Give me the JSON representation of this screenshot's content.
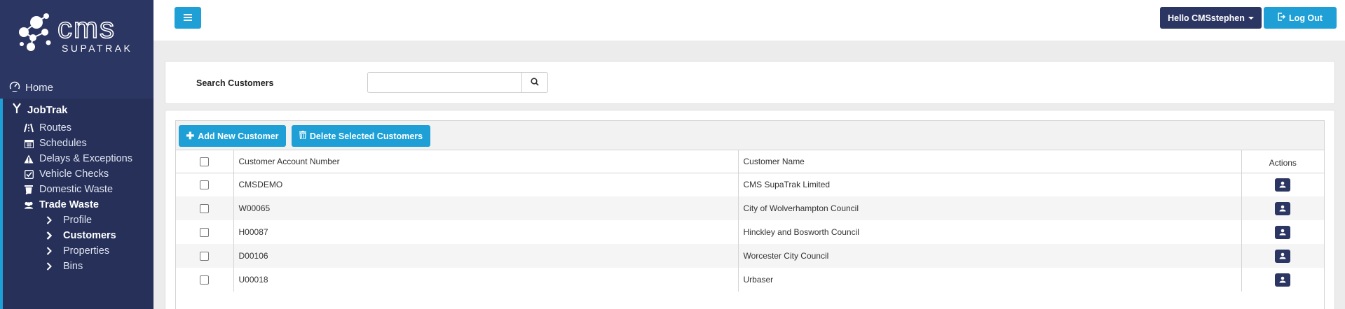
{
  "brand": {
    "name": "cms",
    "sub": "SUPATRAK"
  },
  "sidebar": {
    "home": "Home",
    "jobtrak": "JobTrak",
    "items": [
      {
        "label": "Routes",
        "icon": "road-icon"
      },
      {
        "label": "Schedules",
        "icon": "calendar-icon"
      },
      {
        "label": "Delays & Exceptions",
        "icon": "warning-icon"
      },
      {
        "label": "Vehicle Checks",
        "icon": "checkbox-icon"
      },
      {
        "label": "Domestic Waste",
        "icon": "bin-icon"
      },
      {
        "label": "Trade Waste",
        "icon": "users-icon"
      }
    ],
    "trade_waste_items": [
      {
        "label": "Profile"
      },
      {
        "label": "Customers",
        "active": true
      },
      {
        "label": "Properties"
      },
      {
        "label": "Bins"
      }
    ]
  },
  "topbar": {
    "user_greeting": "Hello CMSstephen",
    "logout": "Log Out"
  },
  "search": {
    "label": "Search Customers",
    "value": "",
    "placeholder": ""
  },
  "customers": {
    "add_button": "Add New Customer",
    "delete_button": "Delete Selected Customers",
    "columns": [
      "Customer Account Number",
      "Customer Name",
      "Actions"
    ],
    "rows": [
      {
        "account": "CMSDEMO",
        "name": "CMS SupaTrak Limited"
      },
      {
        "account": "W00065",
        "name": "City of Wolverhampton Council"
      },
      {
        "account": "H00087",
        "name": "Hinckley and Bosworth Council"
      },
      {
        "account": "D00106",
        "name": "Worcester City Council"
      },
      {
        "account": "U00018",
        "name": "Urbaser"
      }
    ]
  },
  "colors": {
    "sidebar": "#2c3662",
    "accent": "#1ea0d6",
    "navy": "#2c3662"
  }
}
